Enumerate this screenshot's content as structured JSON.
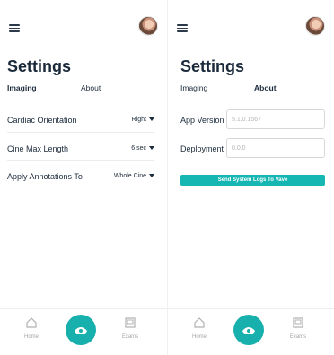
{
  "settings_screen": {
    "title": "Settings",
    "tabs": [
      {
        "label": "Imaging",
        "active": true
      },
      {
        "label": "About",
        "active": false
      }
    ],
    "rows": [
      {
        "label": "Cardiac Orientation",
        "value": "Right"
      },
      {
        "label": "Cine Max Length",
        "value": "6 sec"
      },
      {
        "label": "Apply Annotations To",
        "value": "Whole Cine"
      }
    ]
  },
  "about_screen": {
    "title": "Settings",
    "tabs": [
      {
        "label": "Imaging",
        "active": false
      },
      {
        "label": "About",
        "active": true
      }
    ],
    "fields": [
      {
        "label": "App Version",
        "value": "5.1.0.1567"
      },
      {
        "label": "Deployment",
        "value": "0.0.0"
      }
    ],
    "send_logs_label": "Send System Logs To Vave"
  },
  "bottom_nav": {
    "home_label": "Home",
    "exams_label": "Exams"
  },
  "colors": {
    "accent": "#17b0ad",
    "text": "#1b2a3a",
    "muted": "#a6a6a6"
  },
  "icons": [
    "menu-icon",
    "avatar",
    "home-icon",
    "probe-icon",
    "exams-icon",
    "chevron-down-icon"
  ]
}
